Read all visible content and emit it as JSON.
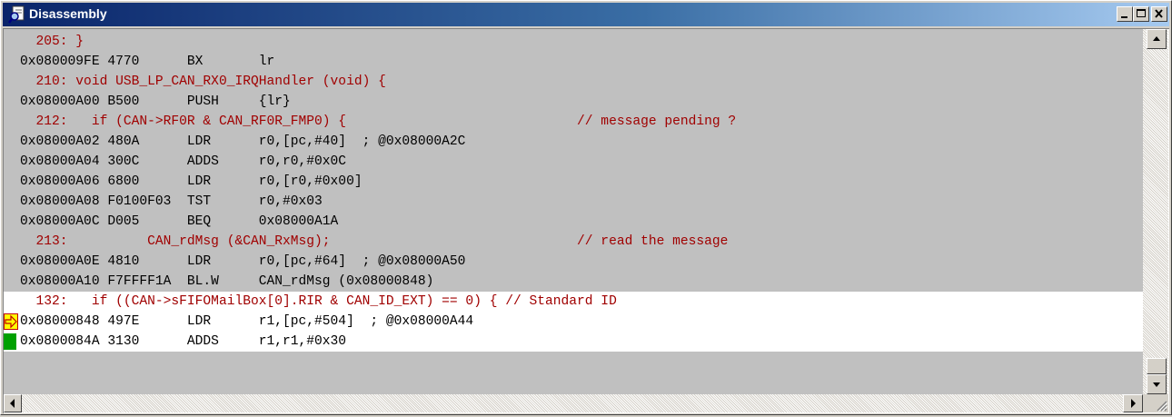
{
  "window": {
    "title": "Disassembly",
    "icon": "disassembly-icon",
    "controls": [
      "minimize-icon",
      "maximize-icon",
      "close-icon"
    ]
  },
  "lines": [
    {
      "kind": "source",
      "text": "  205: }"
    },
    {
      "kind": "asm",
      "text": "0x080009FE 4770      BX       lr"
    },
    {
      "kind": "source",
      "text": "  210: void USB_LP_CAN_RX0_IRQHandler (void) {"
    },
    {
      "kind": "asm",
      "text": "0x08000A00 B500      PUSH     {lr}"
    },
    {
      "kind": "source",
      "text": "  212:   if (CAN->RF0R & CAN_RF0R_FMP0) {                             // message pending ?"
    },
    {
      "kind": "asm",
      "text": "0x08000A02 480A      LDR      r0,[pc,#40]  ; @0x08000A2C"
    },
    {
      "kind": "asm",
      "text": "0x08000A04 300C      ADDS     r0,r0,#0x0C"
    },
    {
      "kind": "asm",
      "text": "0x08000A06 6800      LDR      r0,[r0,#0x00]"
    },
    {
      "kind": "asm",
      "text": "0x08000A08 F0100F03  TST      r0,#0x03"
    },
    {
      "kind": "asm",
      "text": "0x08000A0C D005      BEQ      0x08000A1A"
    },
    {
      "kind": "source",
      "text": "  213:          CAN_rdMsg (&CAN_RxMsg);                               // read the message"
    },
    {
      "kind": "asm",
      "text": "0x08000A0E 4810      LDR      r0,[pc,#64]  ; @0x08000A50"
    },
    {
      "kind": "asm",
      "text": "0x08000A10 F7FFFF1A  BL.W     CAN_rdMsg (0x08000848)"
    },
    {
      "kind": "source",
      "current": true,
      "text": "  132:   if ((CAN->sFIFOMailBox[0].RIR & CAN_ID_EXT) == 0) { // Standard ID"
    },
    {
      "kind": "asm",
      "current": true,
      "marker": "execution-arrow-icon",
      "text": "0x08000848 497E      LDR      r1,[pc,#504]  ; @0x08000A44"
    },
    {
      "kind": "asm",
      "current": true,
      "marker": "green-bar-marker",
      "text": "0x0800084A 3130      ADDS     r1,r1,#0x30"
    }
  ],
  "scrollbars": {
    "vertical_icons": [
      "scroll-up-icon",
      "scroll-down-icon"
    ],
    "horizontal_icons": [
      "scroll-left-icon",
      "scroll-right-icon"
    ]
  },
  "colors": {
    "title_gradient_start": "#0a246a",
    "title_gradient_end": "#a6caf0",
    "source_text": "#a00000",
    "asm_text": "#000000",
    "code_background": "#c0c0c0",
    "current_background": "#ffffff",
    "arrow_marker": "#ffff00",
    "marker_border": "#c00000",
    "green_marker": "#00a000"
  }
}
